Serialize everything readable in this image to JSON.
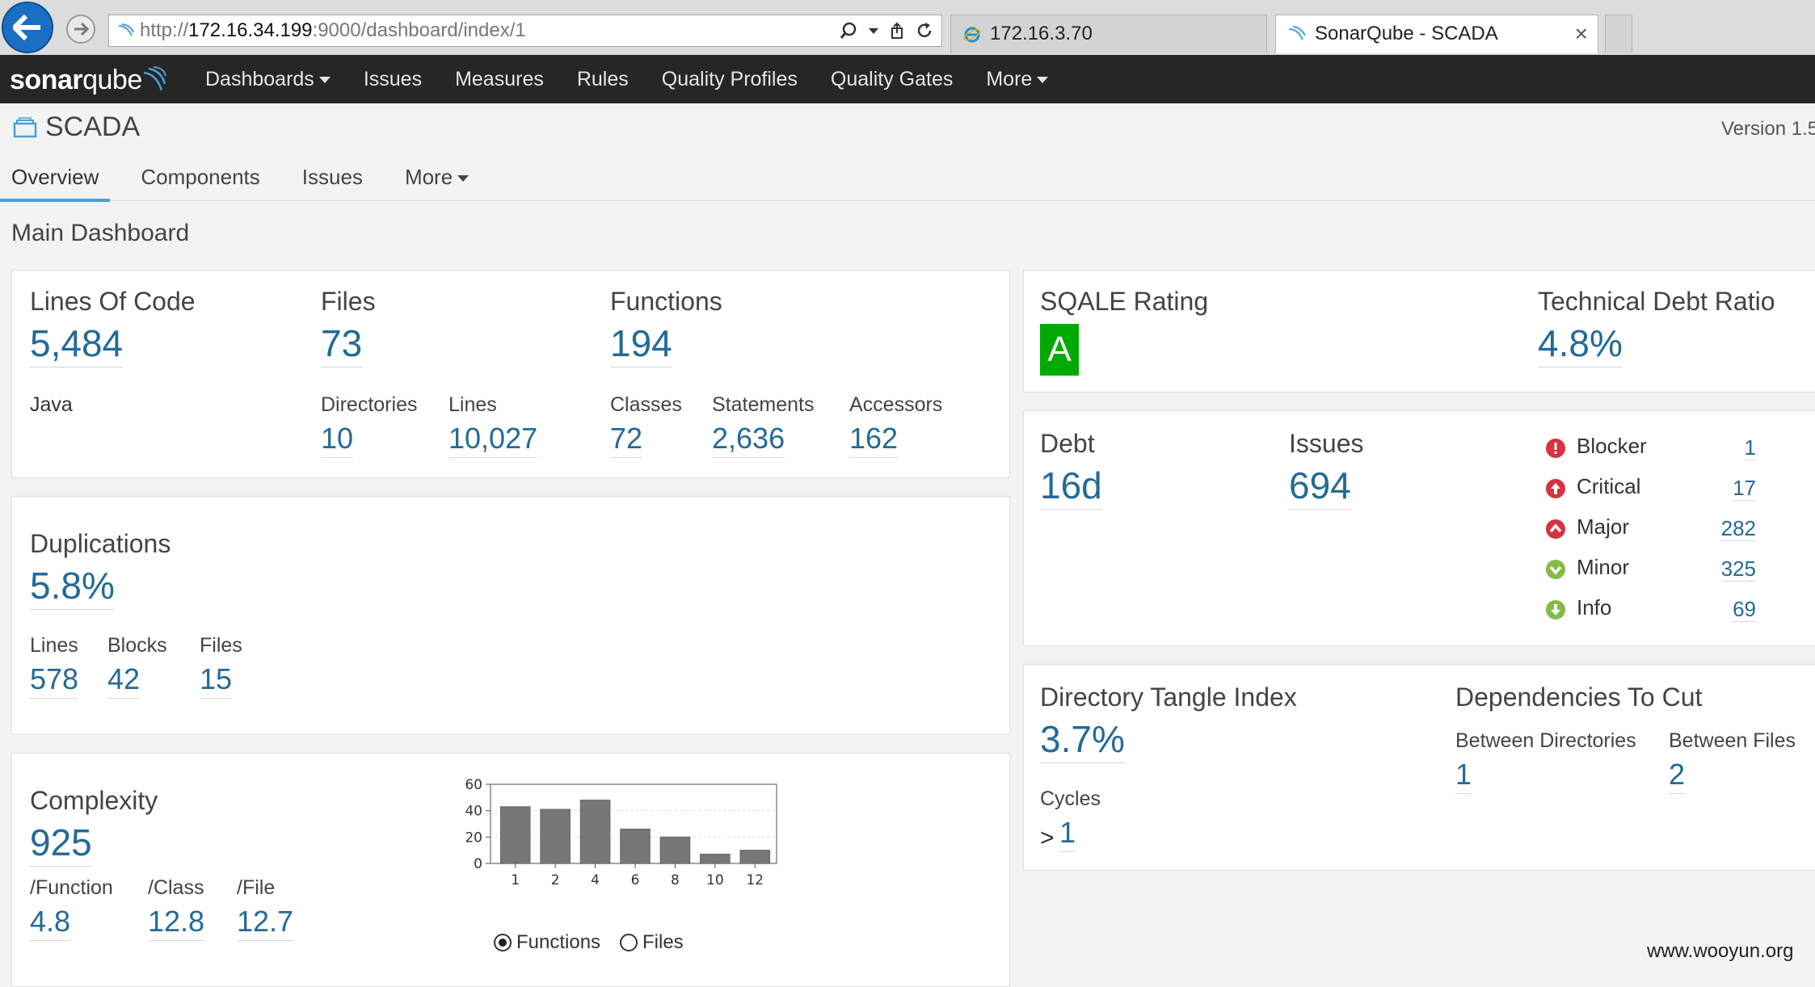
{
  "browser": {
    "url_prefix": "http://",
    "url_host": "172.16.34.199",
    "url_path": ":9000/dashboard/index/1",
    "tabs": [
      {
        "title": "172.16.3.70",
        "active": false
      },
      {
        "title": "SonarQube - SCADA",
        "active": true
      }
    ]
  },
  "nav": {
    "logo_bold": "sonar",
    "logo_thin": "qube",
    "items": [
      "Dashboards",
      "Issues",
      "Measures",
      "Rules",
      "Quality Profiles",
      "Quality Gates",
      "More"
    ]
  },
  "project": {
    "name": "SCADA",
    "version": "Version 1.5",
    "tabs": [
      "Overview",
      "Components",
      "Issues",
      "More"
    ]
  },
  "dashboard": {
    "title": "Main Dashboard",
    "size": {
      "loc_label": "Lines Of Code",
      "loc": "5,484",
      "language": "Java",
      "files_label": "Files",
      "files": "73",
      "functions_label": "Functions",
      "functions": "194",
      "directories_label": "Directories",
      "directories": "10",
      "lines_label": "Lines",
      "lines": "10,027",
      "classes_label": "Classes",
      "classes": "72",
      "statements_label": "Statements",
      "statements": "2,636",
      "accessors_label": "Accessors",
      "accessors": "162"
    },
    "duplications": {
      "label": "Duplications",
      "value": "5.8%",
      "lines_label": "Lines",
      "lines": "578",
      "blocks_label": "Blocks",
      "blocks": "42",
      "files_label": "Files",
      "files": "15"
    },
    "complexity": {
      "label": "Complexity",
      "value": "925",
      "per_function_label": "/Function",
      "per_function": "4.8",
      "per_class_label": "/Class",
      "per_class": "12.8",
      "per_file_label": "/File",
      "per_file": "12.7",
      "radio_functions": "Functions",
      "radio_files": "Files"
    },
    "sqale": {
      "rating_label": "SQALE Rating",
      "rating": "A",
      "rating_color": "#00aa00",
      "ratio_label": "Technical Debt Ratio",
      "ratio": "4.8%"
    },
    "issues": {
      "debt_label": "Debt",
      "debt": "16d",
      "issues_label": "Issues",
      "issues": "694",
      "severities": [
        {
          "name": "Blocker",
          "count": "1",
          "icon": "blocker-icon",
          "color": "#d4333f"
        },
        {
          "name": "Critical",
          "count": "17",
          "icon": "critical-icon",
          "color": "#d4333f"
        },
        {
          "name": "Major",
          "count": "282",
          "icon": "major-icon",
          "color": "#d4333f"
        },
        {
          "name": "Minor",
          "count": "325",
          "icon": "minor-icon",
          "color": "#85bb43"
        },
        {
          "name": "Info",
          "count": "69",
          "icon": "info-icon",
          "color": "#85bb43"
        }
      ]
    },
    "design": {
      "tangle_label": "Directory Tangle Index",
      "tangle": "3.7%",
      "cycles_label": "Cycles",
      "cycles_prefix": ">",
      "cycles": "1",
      "deps_label": "Dependencies To Cut",
      "between_dirs_label": "Between Directories",
      "between_dirs": "1",
      "between_files_label": "Between Files",
      "between_files": "2"
    }
  },
  "chart_data": {
    "type": "bar",
    "categories": [
      "1",
      "2",
      "4",
      "6",
      "8",
      "10",
      "12"
    ],
    "values": [
      43,
      41,
      48,
      26,
      20,
      7,
      10
    ],
    "ylim": [
      0,
      60
    ],
    "yticks": [
      0,
      20,
      40,
      60
    ],
    "grid": true,
    "bar_color": "#777777"
  },
  "watermark": "www.wooyun.org"
}
